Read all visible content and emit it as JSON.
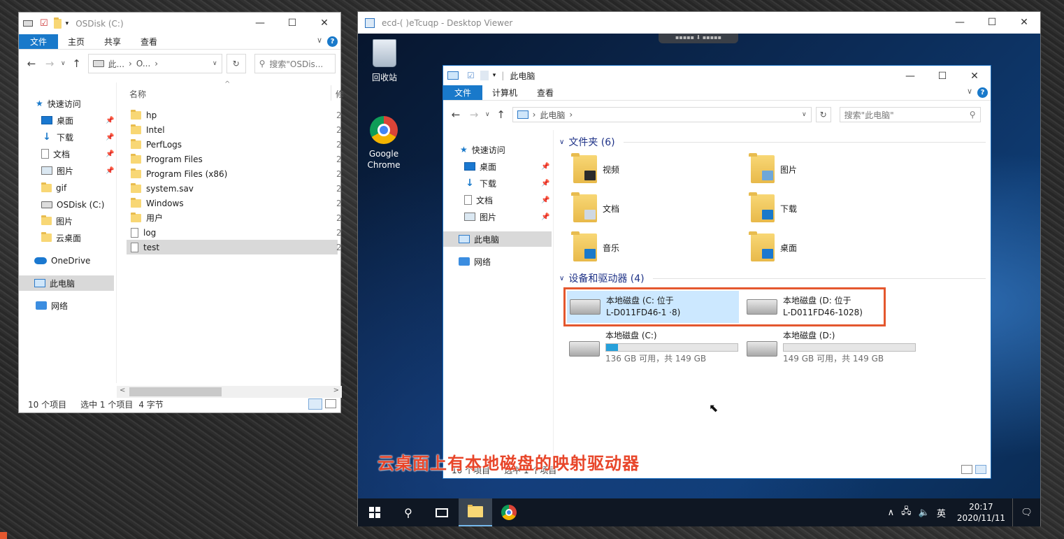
{
  "left_window": {
    "title": "OSDisk (C:)",
    "ribbon_tabs": [
      "文件",
      "主页",
      "共享",
      "查看"
    ],
    "address": {
      "parts": [
        "此...",
        "O...",
        "›"
      ],
      "search_placeholder": "搜索\"OSDis..."
    },
    "column_name": "名称",
    "column_extra": "修",
    "nav": {
      "quick_access": "快速访问",
      "items": [
        "桌面",
        "下载",
        "文档",
        "图片",
        "gif",
        "OSDisk (C:)",
        "图片",
        "云桌面"
      ],
      "onedrive": "OneDrive",
      "this_pc": "此电脑",
      "network": "网络"
    },
    "files": [
      {
        "name": "hp",
        "type": "folder",
        "date": "2"
      },
      {
        "name": "Intel",
        "type": "folder",
        "date": "2"
      },
      {
        "name": "PerfLogs",
        "type": "folder",
        "date": "2"
      },
      {
        "name": "Program Files",
        "type": "folder",
        "date": "2"
      },
      {
        "name": "Program Files (x86)",
        "type": "folder",
        "date": "2"
      },
      {
        "name": "system.sav",
        "type": "folder",
        "date": "2"
      },
      {
        "name": "Windows",
        "type": "folder",
        "date": "2"
      },
      {
        "name": "用户",
        "type": "folder",
        "date": "2"
      },
      {
        "name": "log",
        "type": "doc",
        "date": "2"
      },
      {
        "name": "test",
        "type": "doc",
        "date": "2"
      }
    ],
    "status": {
      "count": "10 个项目",
      "selected": "选中 1 个项目",
      "size": "4 字节"
    }
  },
  "viewer": {
    "title": "ecd-(       )eTcuqp - Desktop Viewer",
    "desktop_icons": {
      "recycle": "回收站",
      "chrome": "Google Chrome"
    },
    "explorer": {
      "title": "此电脑",
      "ribbon_tabs": [
        "文件",
        "计算机",
        "查看"
      ],
      "address": "此电脑",
      "search_placeholder": "搜索\"此电脑\"",
      "nav": {
        "quick_access": "快速访问",
        "items": [
          "桌面",
          "下载",
          "文档",
          "图片"
        ],
        "this_pc": "此电脑",
        "network": "网络"
      },
      "folders_header": "文件夹 (6)",
      "folders": [
        "视频",
        "图片",
        "文档",
        "下载",
        "音乐",
        "桌面"
      ],
      "devices_header": "设备和驱动器 (4)",
      "mapped": [
        {
          "line1": "本地磁盘 (C: 位于",
          "line2": "L-D011FD46-1 ·8)"
        },
        {
          "line1": "本地磁盘 (D: 位于",
          "line2": "L-D011FD46-1028)"
        }
      ],
      "drives": [
        {
          "label": "本地磁盘 (C:)",
          "space": "136 GB 可用，共 149 GB",
          "used_fraction": 0.09
        },
        {
          "label": "本地磁盘 (D:)",
          "space": "149 GB 可用，共 149 GB",
          "used_fraction": 0.0
        }
      ],
      "status": {
        "count": "10 个项目",
        "selected": "选中 1 个项目"
      }
    },
    "caption": "云桌面上有本地磁盘的映射驱动器",
    "taskbar": {
      "ime": "英",
      "time": "20:17",
      "date": "2020/11/11"
    }
  }
}
